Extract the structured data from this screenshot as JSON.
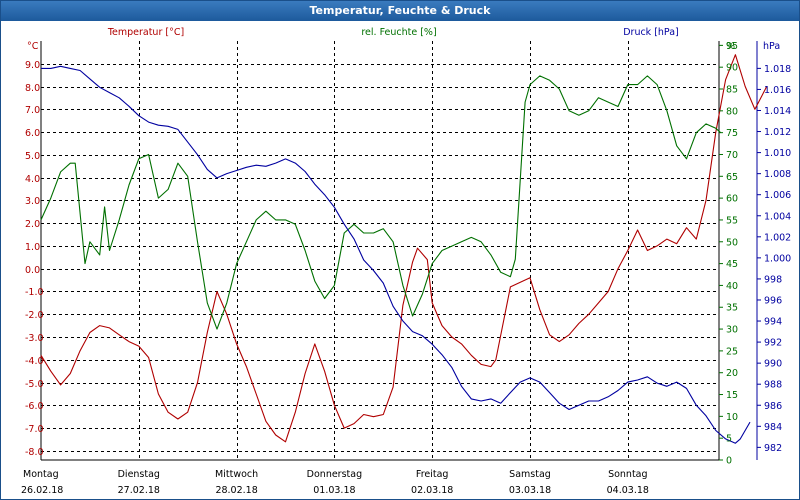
{
  "window": {
    "title": "Temperatur, Feuchte & Druck"
  },
  "chart_data": {
    "type": "line",
    "title": "Temperatur, Feuchte & Druck",
    "grid": true,
    "colors": {
      "temperature": "#b00000",
      "humidity": "#007000",
      "pressure": "#0000a0",
      "grid": "#000000"
    },
    "x": {
      "range": [
        0,
        7
      ],
      "day_labels": [
        "Montag",
        "Dienstag",
        "Mittwoch",
        "Donnerstag",
        "Freitag",
        "Samstag",
        "Sonntag"
      ],
      "date_labels": [
        "26.02.18",
        "27.02.18",
        "28.02.18",
        "01.03.18",
        "02.03.18",
        "03.03.18",
        "04.03.18"
      ]
    },
    "axes": {
      "temperature": {
        "label": "Temperatur [°C]",
        "unit": "°C",
        "range": [
          -8.4,
          10.0
        ],
        "ticks": [
          "9.0",
          "8.0",
          "7.0",
          "6.0",
          "5.0",
          "4.0",
          "3.0",
          "2.0",
          "1.0",
          "0.0",
          "-1.0",
          "-2.0",
          "-3.0",
          "-4.0",
          "-5.0",
          "-6.0",
          "-7.0",
          "-8.0"
        ]
      },
      "humidity": {
        "label": "rel. Feuchte [%]",
        "unit": "%",
        "range": [
          0,
          96
        ],
        "ticks": [
          "0",
          "5",
          "10",
          "15",
          "20",
          "25",
          "30",
          "35",
          "40",
          "45",
          "50",
          "55",
          "60",
          "65",
          "70",
          "75",
          "80",
          "85",
          "90",
          "95"
        ]
      },
      "pressure": {
        "label": "Druck [hPa]",
        "unit": "hPa",
        "range": [
          980.8,
          1020.6
        ],
        "ticks": [
          "982",
          "984",
          "986",
          "988",
          "990",
          "992",
          "994",
          "996",
          "998",
          "1.000",
          "1.002",
          "1.004",
          "1.006",
          "1.008",
          "1.010",
          "1.012",
          "1.014",
          "1.016",
          "1.018"
        ]
      }
    },
    "series": [
      {
        "name": "Temperatur [°C]",
        "axis": "temperature",
        "points": [
          [
            0.0,
            -3.8
          ],
          [
            0.1,
            -4.5
          ],
          [
            0.2,
            -5.1
          ],
          [
            0.3,
            -4.6
          ],
          [
            0.4,
            -3.6
          ],
          [
            0.5,
            -2.8
          ],
          [
            0.6,
            -2.5
          ],
          [
            0.7,
            -2.6
          ],
          [
            0.8,
            -2.9
          ],
          [
            0.9,
            -3.2
          ],
          [
            1.0,
            -3.4
          ],
          [
            1.1,
            -3.9
          ],
          [
            1.2,
            -5.5
          ],
          [
            1.3,
            -6.3
          ],
          [
            1.4,
            -6.6
          ],
          [
            1.5,
            -6.3
          ],
          [
            1.6,
            -5.0
          ],
          [
            1.7,
            -2.8
          ],
          [
            1.8,
            -1.0
          ],
          [
            1.9,
            -2.0
          ],
          [
            2.0,
            -3.3
          ],
          [
            2.1,
            -4.3
          ],
          [
            2.2,
            -5.5
          ],
          [
            2.3,
            -6.7
          ],
          [
            2.4,
            -7.3
          ],
          [
            2.5,
            -7.6
          ],
          [
            2.6,
            -6.3
          ],
          [
            2.7,
            -4.6
          ],
          [
            2.8,
            -3.3
          ],
          [
            2.9,
            -4.5
          ],
          [
            3.0,
            -6.0
          ],
          [
            3.1,
            -7.0
          ],
          [
            3.2,
            -6.8
          ],
          [
            3.3,
            -6.4
          ],
          [
            3.4,
            -6.5
          ],
          [
            3.5,
            -6.4
          ],
          [
            3.6,
            -5.2
          ],
          [
            3.7,
            -1.6
          ],
          [
            3.8,
            0.3
          ],
          [
            3.85,
            0.9
          ],
          [
            3.95,
            0.4
          ],
          [
            4.0,
            -1.5
          ],
          [
            4.1,
            -2.5
          ],
          [
            4.2,
            -3.0
          ],
          [
            4.3,
            -3.3
          ],
          [
            4.4,
            -3.8
          ],
          [
            4.5,
            -4.2
          ],
          [
            4.6,
            -4.3
          ],
          [
            4.65,
            -4.0
          ],
          [
            4.8,
            -0.8
          ],
          [
            5.0,
            -0.4
          ],
          [
            5.1,
            -1.8
          ],
          [
            5.2,
            -2.9
          ],
          [
            5.3,
            -3.2
          ],
          [
            5.4,
            -2.9
          ],
          [
            5.5,
            -2.4
          ],
          [
            5.6,
            -2.0
          ],
          [
            5.7,
            -1.5
          ],
          [
            5.8,
            -1.0
          ],
          [
            5.9,
            0.0
          ],
          [
            6.0,
            0.8
          ],
          [
            6.1,
            1.7
          ],
          [
            6.2,
            0.8
          ],
          [
            6.3,
            1.0
          ],
          [
            6.4,
            1.3
          ],
          [
            6.5,
            1.1
          ],
          [
            6.6,
            1.8
          ],
          [
            6.7,
            1.3
          ],
          [
            6.8,
            3.0
          ],
          [
            6.9,
            6.0
          ],
          [
            7.0,
            8.3
          ],
          [
            7.1,
            9.4
          ],
          [
            7.2,
            8.0
          ],
          [
            7.3,
            7.0
          ],
          [
            7.42,
            8.0
          ]
        ]
      },
      {
        "name": "rel. Feuchte [%]",
        "axis": "humidity",
        "points": [
          [
            0.0,
            55
          ],
          [
            0.1,
            60
          ],
          [
            0.2,
            66
          ],
          [
            0.3,
            68
          ],
          [
            0.35,
            68
          ],
          [
            0.45,
            45
          ],
          [
            0.5,
            50
          ],
          [
            0.6,
            47
          ],
          [
            0.65,
            58
          ],
          [
            0.7,
            48
          ],
          [
            0.8,
            55
          ],
          [
            0.9,
            63
          ],
          [
            1.0,
            69
          ],
          [
            1.1,
            70
          ],
          [
            1.2,
            60
          ],
          [
            1.3,
            62
          ],
          [
            1.4,
            68
          ],
          [
            1.5,
            65
          ],
          [
            1.6,
            50
          ],
          [
            1.7,
            36
          ],
          [
            1.8,
            30
          ],
          [
            1.9,
            36
          ],
          [
            2.0,
            45
          ],
          [
            2.1,
            50
          ],
          [
            2.2,
            55
          ],
          [
            2.3,
            57
          ],
          [
            2.4,
            55
          ],
          [
            2.5,
            55
          ],
          [
            2.6,
            54
          ],
          [
            2.7,
            48
          ],
          [
            2.8,
            41
          ],
          [
            2.9,
            37
          ],
          [
            3.0,
            40
          ],
          [
            3.1,
            52
          ],
          [
            3.2,
            54
          ],
          [
            3.3,
            52
          ],
          [
            3.4,
            52
          ],
          [
            3.5,
            53
          ],
          [
            3.6,
            50
          ],
          [
            3.7,
            40
          ],
          [
            3.8,
            33
          ],
          [
            3.9,
            38
          ],
          [
            4.0,
            45
          ],
          [
            4.1,
            48
          ],
          [
            4.2,
            49
          ],
          [
            4.3,
            50
          ],
          [
            4.4,
            51
          ],
          [
            4.5,
            50
          ],
          [
            4.6,
            47
          ],
          [
            4.7,
            43
          ],
          [
            4.8,
            42
          ],
          [
            4.85,
            46
          ],
          [
            4.95,
            82
          ],
          [
            5.0,
            86
          ],
          [
            5.1,
            88
          ],
          [
            5.2,
            87
          ],
          [
            5.3,
            85
          ],
          [
            5.4,
            80
          ],
          [
            5.5,
            79
          ],
          [
            5.6,
            80
          ],
          [
            5.7,
            83
          ],
          [
            5.8,
            82
          ],
          [
            5.9,
            81
          ],
          [
            6.0,
            86
          ],
          [
            6.1,
            86
          ],
          [
            6.2,
            88
          ],
          [
            6.3,
            86
          ],
          [
            6.4,
            80
          ],
          [
            6.5,
            72
          ],
          [
            6.6,
            69
          ],
          [
            6.7,
            75
          ],
          [
            6.8,
            77
          ],
          [
            6.9,
            76
          ],
          [
            6.95,
            75
          ]
        ]
      },
      {
        "name": "Druck [hPa]",
        "axis": "pressure",
        "points": [
          [
            0.0,
            1018.0
          ],
          [
            0.1,
            1018.0
          ],
          [
            0.2,
            1018.2
          ],
          [
            0.3,
            1018.0
          ],
          [
            0.4,
            1017.8
          ],
          [
            0.5,
            1017.0
          ],
          [
            0.6,
            1016.2
          ],
          [
            0.7,
            1015.7
          ],
          [
            0.8,
            1015.2
          ],
          [
            0.9,
            1014.4
          ],
          [
            1.0,
            1013.5
          ],
          [
            1.1,
            1012.9
          ],
          [
            1.2,
            1012.6
          ],
          [
            1.3,
            1012.5
          ],
          [
            1.4,
            1012.2
          ],
          [
            1.5,
            1011.0
          ],
          [
            1.6,
            1009.8
          ],
          [
            1.7,
            1008.4
          ],
          [
            1.8,
            1007.6
          ],
          [
            1.9,
            1008.0
          ],
          [
            2.0,
            1008.3
          ],
          [
            2.1,
            1008.6
          ],
          [
            2.2,
            1008.8
          ],
          [
            2.3,
            1008.7
          ],
          [
            2.4,
            1009.0
          ],
          [
            2.5,
            1009.4
          ],
          [
            2.6,
            1009.0
          ],
          [
            2.7,
            1008.2
          ],
          [
            2.8,
            1007.0
          ],
          [
            2.9,
            1006.0
          ],
          [
            3.0,
            1004.8
          ],
          [
            3.1,
            1003.2
          ],
          [
            3.2,
            1001.8
          ],
          [
            3.3,
            999.8
          ],
          [
            3.4,
            998.8
          ],
          [
            3.5,
            997.6
          ],
          [
            3.6,
            995.4
          ],
          [
            3.7,
            994.0
          ],
          [
            3.8,
            993.0
          ],
          [
            3.9,
            992.6
          ],
          [
            4.0,
            991.8
          ],
          [
            4.1,
            990.8
          ],
          [
            4.2,
            989.6
          ],
          [
            4.3,
            987.8
          ],
          [
            4.4,
            986.6
          ],
          [
            4.5,
            986.4
          ],
          [
            4.6,
            986.6
          ],
          [
            4.7,
            986.2
          ],
          [
            4.8,
            987.2
          ],
          [
            4.9,
            988.2
          ],
          [
            5.0,
            988.6
          ],
          [
            5.1,
            988.2
          ],
          [
            5.2,
            987.2
          ],
          [
            5.3,
            986.2
          ],
          [
            5.4,
            985.6
          ],
          [
            5.5,
            986.0
          ],
          [
            5.6,
            986.4
          ],
          [
            5.7,
            986.4
          ],
          [
            5.8,
            986.8
          ],
          [
            5.9,
            987.4
          ],
          [
            6.0,
            988.2
          ],
          [
            6.1,
            988.4
          ],
          [
            6.2,
            988.7
          ],
          [
            6.3,
            988.1
          ],
          [
            6.4,
            987.8
          ],
          [
            6.5,
            988.2
          ],
          [
            6.6,
            987.6
          ],
          [
            6.7,
            986.0
          ],
          [
            6.8,
            985.0
          ],
          [
            6.9,
            983.6
          ],
          [
            7.0,
            982.8
          ],
          [
            7.1,
            982.4
          ],
          [
            7.15,
            982.8
          ],
          [
            7.25,
            984.4
          ]
        ]
      }
    ]
  }
}
